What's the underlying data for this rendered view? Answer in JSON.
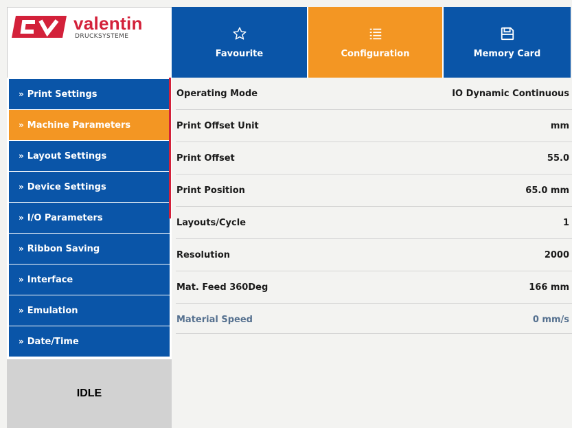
{
  "logo": {
    "title": "valentin",
    "subtitle": "DRUCKSYSTEME",
    "mark": "CV",
    "brand_color": "#d3213a"
  },
  "tabs": [
    {
      "label": "Favourite",
      "icon": "star-icon",
      "active": false
    },
    {
      "label": "Configuration",
      "icon": "list-icon",
      "active": true
    },
    {
      "label": "Memory Card",
      "icon": "save-icon",
      "active": false
    }
  ],
  "sidebar": {
    "chevron": "»",
    "items": [
      {
        "label": "Print Settings",
        "active": false
      },
      {
        "label": "Machine Parameters",
        "active": true
      },
      {
        "label": "Layout Settings",
        "active": false
      },
      {
        "label": "Device Settings",
        "active": false
      },
      {
        "label": "I/O Parameters",
        "active": false
      },
      {
        "label": "Ribbon Saving",
        "active": false
      },
      {
        "label": "Interface",
        "active": false
      },
      {
        "label": "Emulation",
        "active": false
      },
      {
        "label": "Date/Time",
        "active": false
      }
    ]
  },
  "status": {
    "text": "IDLE"
  },
  "params": [
    {
      "label": "Operating Mode",
      "value": "IO Dynamic Continuous"
    },
    {
      "label": "Print Offset Unit",
      "value": "mm"
    },
    {
      "label": "Print Offset",
      "value": "55.0"
    },
    {
      "label": "Print Position",
      "value": "65.0 mm"
    },
    {
      "label": "Layouts/Cycle",
      "value": "1"
    },
    {
      "label": "Resolution",
      "value": "2000"
    },
    {
      "label": "Mat. Feed 360Deg",
      "value": "166 mm"
    },
    {
      "label": "Material Speed",
      "value": "0 mm/s"
    }
  ],
  "colors": {
    "primary_blue": "#0a55a8",
    "active_orange": "#f39623",
    "background": "#f3f3f1",
    "status_bg": "#d2d2d2"
  }
}
